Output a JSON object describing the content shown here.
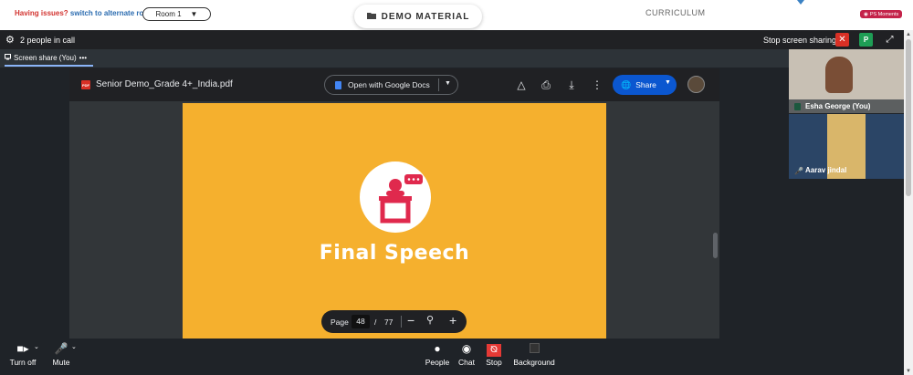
{
  "topbar": {
    "issue_text": "Having issues?",
    "switch_link": "switch to alternate room",
    "room_select": "Room 1",
    "demo_material": "DEMO MATERIAL",
    "curriculum": "CURRICULUM",
    "ps_moments": "PS Moments"
  },
  "callbar": {
    "people_count": "2 people in call",
    "stop_sharing": "Stop screen sharing",
    "p_label": "P"
  },
  "share_tab": {
    "label": "Screen share (You)",
    "more": "•••"
  },
  "viewer": {
    "pdf_badge": "PDF",
    "file_name": "Senior Demo_Grade 4+_India.pdf",
    "open_with": "Open with Google Docs",
    "share": "Share",
    "slide_title": "Final Speech",
    "page_label": "Page",
    "current_page": "48",
    "page_sep": "/",
    "total_pages": "77"
  },
  "participants": [
    {
      "name": "Esha George (You)"
    },
    {
      "name": "Aarav jindal"
    }
  ],
  "controls": {
    "turn_off": "Turn off",
    "mute": "Mute",
    "people": "People",
    "chat": "Chat",
    "stop": "Stop",
    "background": "Background"
  },
  "colors": {
    "slide_bg": "#f5b02e",
    "accent_red": "#e0294d",
    "share_blue": "#0b57d0"
  }
}
